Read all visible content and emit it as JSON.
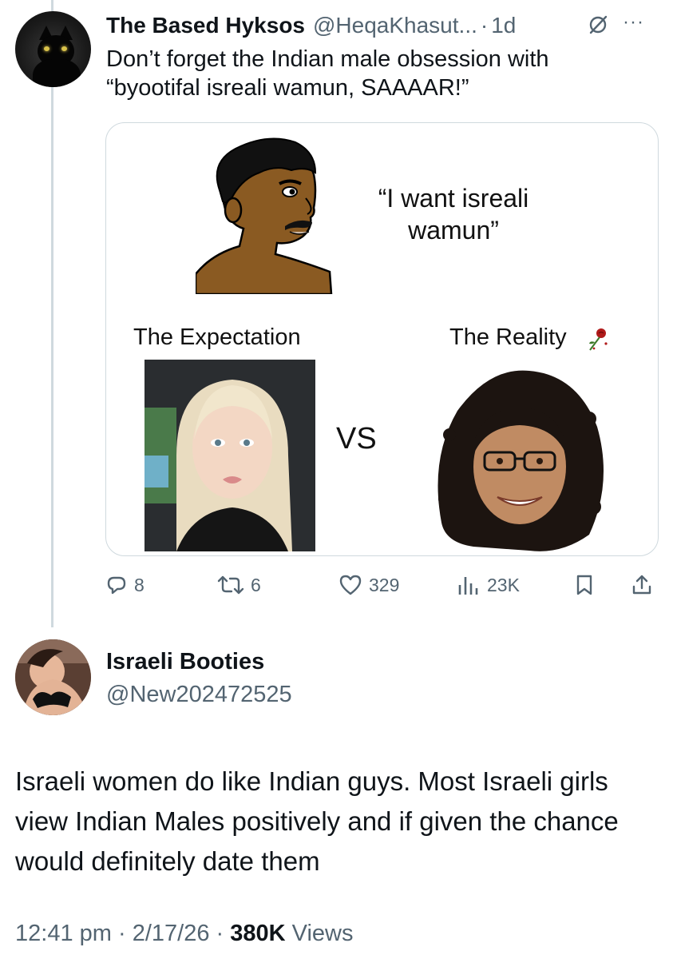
{
  "tweet1": {
    "name": "The Based Hyksos",
    "handle": "@HeqaKhasut...",
    "separator": "·",
    "time": "1d",
    "text": "Don’t forget the Indian male obsession with “byootifal isreali wamun, SAAAAR!”",
    "media": {
      "quote": "“I want isreali wamun”",
      "left_label": "The Expectation",
      "right_label": "The Reality",
      "vs": "VS"
    },
    "actions": {
      "replies": "8",
      "reposts": "6",
      "likes": "329",
      "views": "23K"
    }
  },
  "tweet2": {
    "name": "Israeli Booties",
    "handle": "@New202472525",
    "text": "Israeli women do like Indian guys. Most Israeli girls view Indian Males positively and if given the chance would definitely date them",
    "time": "12:41 pm",
    "date": "2/17/26",
    "separator": "·",
    "views_count": "380K",
    "views_label": "Views"
  },
  "icons": [
    "reply-icon",
    "repost-icon",
    "like-icon",
    "views-icon",
    "bookmark-icon",
    "share-icon",
    "grok-icon",
    "more-icon",
    "rose-icon"
  ],
  "colors": {
    "text": "#0f1419",
    "secondary": "#536471",
    "border": "#cfd9de",
    "background": "#ffffff"
  }
}
